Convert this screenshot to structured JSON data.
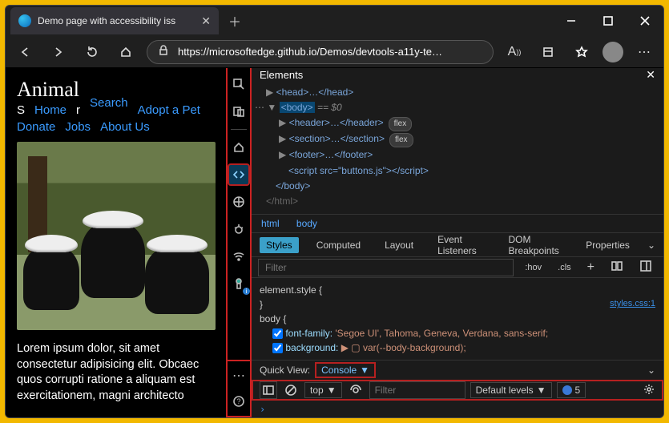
{
  "window": {
    "title": "Demo page with accessibility iss"
  },
  "toolbar": {
    "url": "https://microsoftedge.github.io/Demos/devtools-a11y-te…"
  },
  "page": {
    "heading": "Animal",
    "nav": [
      "Home",
      "Search",
      "Adopt a Pet",
      "Donate",
      "Jobs",
      "About Us"
    ],
    "shelter_prefix": "S",
    "shelter_suffix": "r",
    "lorem": "Lorem ipsum dolor, sit amet consectetur adipisicing elit. Obcaec quos corrupti ratione a aliquam est exercitationem, magni architecto"
  },
  "sidebar": {
    "items": [
      "inspect",
      "device",
      "home",
      "sources",
      "network",
      "bug",
      "wifi",
      "lighthouse"
    ],
    "active": "sources",
    "bottom": [
      "more",
      "help"
    ]
  },
  "elements": {
    "panel_title": "Elements",
    "dom": {
      "head": "<head>…</head>",
      "body_open": "<body>",
      "body_eq": " == $0",
      "header": "<header>…</header>",
      "header_pill": "flex",
      "section": "<section>…</section>",
      "section_pill": "flex",
      "footer": "<footer>…</footer>",
      "script": "<script src=\"buttons.js\"></​script>",
      "body_close": "</body>",
      "html_close": "</html>"
    },
    "crumbs": [
      "html",
      "body"
    ]
  },
  "styles": {
    "tabs": [
      "Styles",
      "Computed",
      "Layout",
      "Event Listeners",
      "DOM Breakpoints",
      "Properties"
    ],
    "active": "Styles",
    "filter_placeholder": "Filter",
    "hov": ":hov",
    "cls": ".cls",
    "link": "styles.css:1",
    "rule1_sel": "element.style {",
    "rule2_sel": "body {",
    "prop1_name": "font-family:",
    "prop1_val": " 'Segoe UI', Tahoma, Geneva, Verdana, sans-serif;",
    "prop2_name": "background:",
    "prop2_val": " ▶ ▢ var(--body-background);"
  },
  "quickview": {
    "label": "Quick View:",
    "selected": "Console",
    "top": "top",
    "filter_placeholder": "Filter",
    "levels": "Default levels",
    "issues_count": "5",
    "prompt": "›"
  }
}
